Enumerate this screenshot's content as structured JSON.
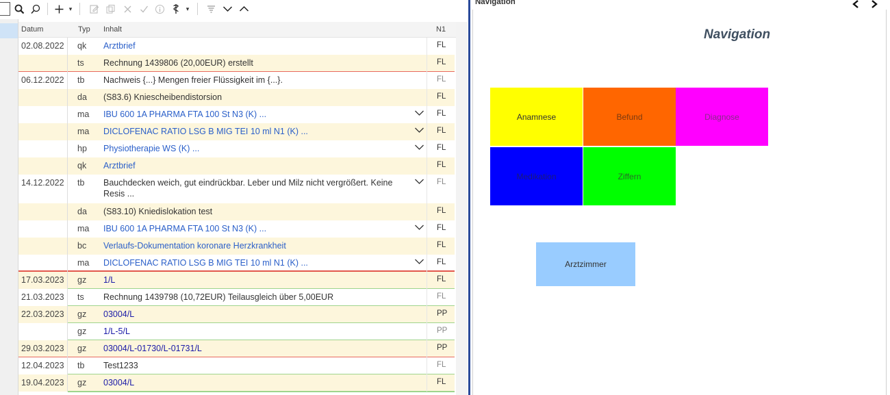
{
  "toolbar": {
    "icons": [
      "search-icon",
      "search-alt-icon",
      "add-icon",
      "dropdown-icon",
      "edit-doc-icon",
      "copy-icon",
      "delete-icon",
      "check-icon",
      "info-icon",
      "sign-icon",
      "dropdown-icon",
      "filter-icon",
      "chevron-down-icon",
      "chevron-up-icon"
    ]
  },
  "grid": {
    "headers": {
      "datum": "Datum",
      "typ": "Typ",
      "inhalt": "Inhalt",
      "n1": "N1"
    },
    "rows": [
      {
        "datum": "02.08.2022",
        "typ": "qk",
        "inhalt": "Arztbrief",
        "n1": "FL",
        "style": "link",
        "chev": false
      },
      {
        "datum": "",
        "typ": "ts",
        "inhalt": "Rechnung 1439806 (20,00EUR) erstellt",
        "n1": "FL",
        "style": "normal",
        "chev": false
      },
      {
        "datum": "06.12.2022",
        "typ": "tb",
        "inhalt": "Nachweis {...} Mengen freier Flüssigkeit im {...}.",
        "n1": "FL",
        "style": "normal",
        "chev": false
      },
      {
        "datum": "",
        "typ": "da",
        "inhalt": "(S83.6) Kniescheibendistorsion",
        "n1": "FL",
        "style": "normal",
        "chev": false
      },
      {
        "datum": "",
        "typ": "ma",
        "inhalt": "IBU 600 1A PHARMA FTA 100 St N3 (K) ...",
        "n1": "FL",
        "style": "link",
        "chev": true
      },
      {
        "datum": "",
        "typ": "ma",
        "inhalt": "DICLOFENAC RATIO LSG B MIG TEI 10 ml N1 (K) ...",
        "n1": "FL",
        "style": "link",
        "chev": true
      },
      {
        "datum": "",
        "typ": "hp",
        "inhalt": "Physiotherapie WS (K) ...",
        "n1": "FL",
        "style": "link",
        "chev": true
      },
      {
        "datum": "",
        "typ": "qk",
        "inhalt": "Arztbrief",
        "n1": "FL",
        "style": "link",
        "chev": false
      },
      {
        "datum": "14.12.2022",
        "typ": "tb",
        "inhalt": "Bauchdecken weich, gut eindrückbar. Leber und Milz nicht vergrößert. Keine Resis ...",
        "n1": "FL",
        "style": "normal",
        "chev": true
      },
      {
        "datum": "",
        "typ": "da",
        "inhalt": "(S83.10) Kniedislokation test",
        "n1": "FL",
        "style": "normal",
        "chev": false
      },
      {
        "datum": "",
        "typ": "ma",
        "inhalt": "IBU 600 1A PHARMA FTA 100 St N3 (K) ...",
        "n1": "FL",
        "style": "link",
        "chev": true
      },
      {
        "datum": "",
        "typ": "bc",
        "inhalt": "Verlaufs-Dokumentation koronare Herzkrankheit",
        "n1": "FL",
        "style": "link",
        "chev": false
      },
      {
        "datum": "",
        "typ": "ma",
        "inhalt": "DICLOFENAC RATIO LSG B MIG TEI 10 ml N1 (K) ...",
        "n1": "FL",
        "style": "link",
        "chev": true
      },
      {
        "datum": "17.03.2023",
        "typ": "gz",
        "inhalt": "1/L",
        "n1": "FL",
        "style": "dark",
        "chev": false
      },
      {
        "datum": "21.03.2023",
        "typ": "ts",
        "inhalt": "Rechnung 1439798 (10,72EUR) Teilausgleich über 5,00EUR",
        "n1": "FL",
        "style": "normal",
        "chev": false
      },
      {
        "datum": "22.03.2023",
        "typ": "gz",
        "inhalt": "03004/L",
        "n1": "PP",
        "style": "dark",
        "chev": false
      },
      {
        "datum": "",
        "typ": "gz",
        "inhalt": "1/L-5/L",
        "n1": "PP",
        "style": "dark",
        "chev": false
      },
      {
        "datum": "29.03.2023",
        "typ": "gz",
        "inhalt": "03004/L-01730/L-01731/L",
        "n1": "PP",
        "style": "dark",
        "chev": false
      },
      {
        "datum": "12.04.2023",
        "typ": "tb",
        "inhalt": "Test1233",
        "n1": "FL",
        "style": "normal",
        "chev": false
      },
      {
        "datum": "19.04.2023",
        "typ": "gz",
        "inhalt": "03004/L",
        "n1": "FL",
        "style": "dark",
        "chev": false
      }
    ]
  },
  "navigation": {
    "caption": "Navigation",
    "title": "Navigation",
    "tiles": [
      {
        "label": "Anamnese",
        "color": "#ffff00",
        "text_color": "#333333"
      },
      {
        "label": "Befund",
        "color": "#ff6600",
        "text_color": "#7a3a10"
      },
      {
        "label": "Diagnose",
        "color": "#ff00ff",
        "text_color": "#8a2a8a"
      },
      {
        "label": "Medikation",
        "color": "#0000ff",
        "text_color": "#1a1a7a"
      },
      {
        "label": "Ziffern",
        "color": "#00ff00",
        "text_color": "#2a6a2a"
      },
      {
        "label": "Arztzimmer",
        "color": "#99ccff",
        "text_color": "#333333"
      }
    ]
  }
}
